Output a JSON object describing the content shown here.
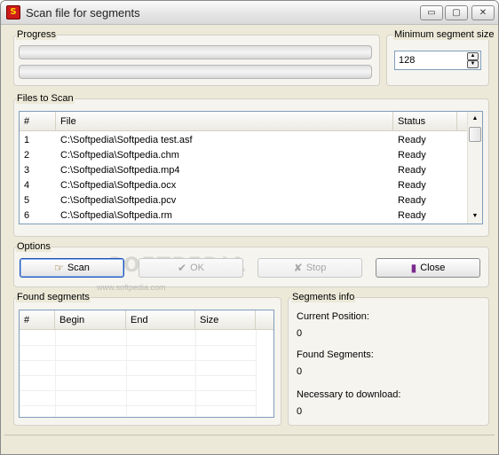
{
  "window": {
    "title": "Scan file for segments",
    "controls": {
      "minimize": "▭",
      "maximize": "▢",
      "close": "✕"
    }
  },
  "progress": {
    "label": "Progress",
    "bars": [
      {
        "value": 0
      },
      {
        "value": 0
      }
    ]
  },
  "min_segment": {
    "label": "Minimum segment size",
    "value": "128"
  },
  "files": {
    "label": "Files to Scan",
    "columns": [
      "#",
      "File",
      "Status"
    ],
    "rows": [
      {
        "num": "1",
        "file": "C:\\Softpedia\\Softpedia test.asf",
        "status": "Ready"
      },
      {
        "num": "2",
        "file": "C:\\Softpedia\\Softpedia.chm",
        "status": "Ready"
      },
      {
        "num": "3",
        "file": "C:\\Softpedia\\Softpedia.mp4",
        "status": "Ready"
      },
      {
        "num": "4",
        "file": "C:\\Softpedia\\Softpedia.ocx",
        "status": "Ready"
      },
      {
        "num": "5",
        "file": "C:\\Softpedia\\Softpedia.pcv",
        "status": "Ready"
      },
      {
        "num": "6",
        "file": "C:\\Softpedia\\Softpedia.rm",
        "status": "Ready"
      }
    ]
  },
  "options": {
    "label": "Options",
    "buttons": {
      "scan": {
        "label": "Scan",
        "icon": "scan-hand-icon"
      },
      "ok": {
        "label": "OK",
        "icon": "checkmark-icon"
      },
      "stop": {
        "label": "Stop",
        "icon": "stop-x-icon"
      },
      "close": {
        "label": "Close",
        "icon": "exit-door-icon"
      }
    }
  },
  "found_segments": {
    "label": "Found segments",
    "columns": [
      "#",
      "Begin",
      "End",
      "Size"
    ]
  },
  "segments_info": {
    "label": "Segments info",
    "current_position_label": "Current Position:",
    "current_position_value": "0",
    "found_segments_label": "Found Segments:",
    "found_segments_value": "0",
    "necessary_label": "Necessary to download:",
    "necessary_value": "0"
  },
  "watermark": {
    "text": "SOFTPEDIA",
    "sub": "www.softpedia.com"
  }
}
